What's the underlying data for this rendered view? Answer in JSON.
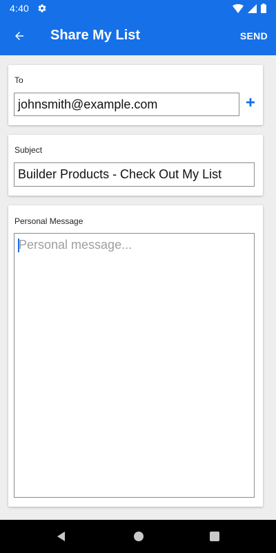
{
  "status_bar": {
    "time": "4:40",
    "icons": [
      "gear-icon",
      "wifi-icon",
      "cellular-signal-icon",
      "battery-icon"
    ]
  },
  "app_bar": {
    "title": "Share My List",
    "send_label": "SEND",
    "back_icon": "arrow-left-icon"
  },
  "form": {
    "to": {
      "label": "To",
      "value": "johnsmith@example.com",
      "add_icon": "plus-icon"
    },
    "subject": {
      "label": "Subject",
      "value": "Builder Products - Check Out My List"
    },
    "message": {
      "label": "Personal Message",
      "value": "",
      "placeholder": "Personal message..."
    }
  },
  "nav_bar": {
    "icons": [
      "nav-back-icon",
      "nav-home-icon",
      "nav-recents-icon"
    ]
  },
  "colors": {
    "primary": "#1670e8",
    "background": "#eeeeee",
    "card": "#ffffff",
    "placeholder": "#9e9e9e"
  }
}
